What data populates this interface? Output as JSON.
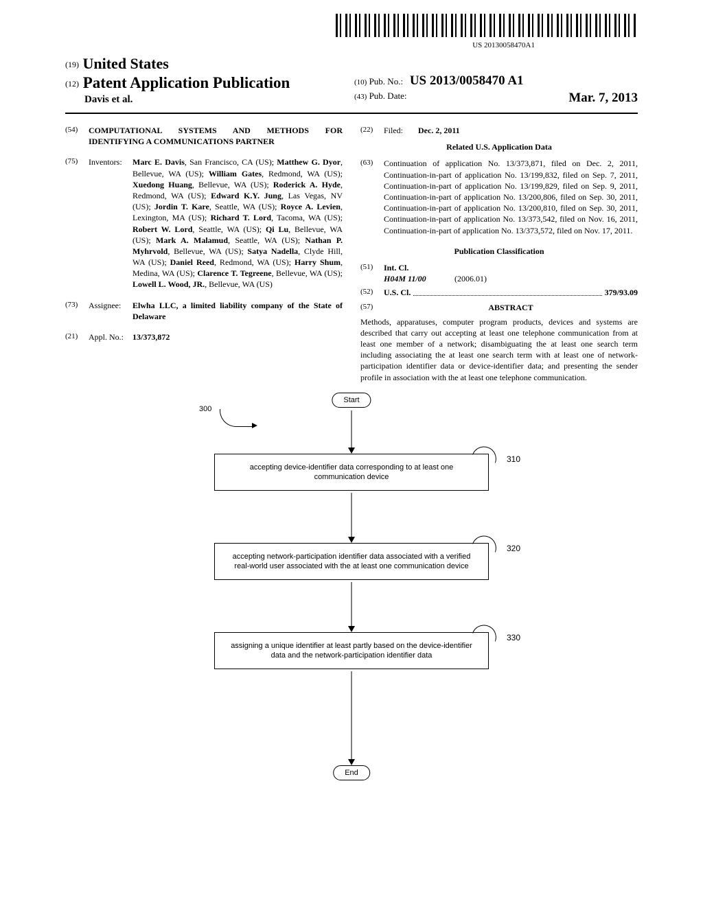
{
  "barcode_number": "US 20130058470A1",
  "header": {
    "country_num": "(19)",
    "country": "United States",
    "pub_num": "(12)",
    "pub_type": "Patent Application Publication",
    "authors": "Davis et al.",
    "pubno_num": "(10)",
    "pubno_label": "Pub. No.:",
    "pubno_value": "US 2013/0058470 A1",
    "pubdate_num": "(43)",
    "pubdate_label": "Pub. Date:",
    "pubdate_value": "Mar. 7, 2013"
  },
  "left": {
    "title_num": "(54)",
    "title": "COMPUTATIONAL SYSTEMS AND METHODS FOR IDENTIFYING A COMMUNICATIONS PARTNER",
    "inventors_num": "(75)",
    "inventors_label": "Inventors:",
    "inventors": [
      {
        "name": "Marc E. Davis",
        "loc": "San Francisco, CA (US)"
      },
      {
        "name": "Matthew G. Dyor",
        "loc": "Bellevue, WA (US)"
      },
      {
        "name": "William Gates",
        "loc": "Redmond, WA (US)"
      },
      {
        "name": "Xuedong Huang",
        "loc": "Bellevue, WA (US)"
      },
      {
        "name": "Roderick A. Hyde",
        "loc": "Redmond, WA (US)"
      },
      {
        "name": "Edward K.Y. Jung",
        "loc": "Las Vegas, NV (US)"
      },
      {
        "name": "Jordin T. Kare",
        "loc": "Seattle, WA (US)"
      },
      {
        "name": "Royce A. Levien",
        "loc": "Lexington, MA (US)"
      },
      {
        "name": "Richard T. Lord",
        "loc": "Tacoma, WA (US)"
      },
      {
        "name": "Robert W. Lord",
        "loc": "Seattle, WA (US)"
      },
      {
        "name": "Qi Lu",
        "loc": "Bellevue, WA (US)"
      },
      {
        "name": "Mark A. Malamud",
        "loc": "Seattle, WA (US)"
      },
      {
        "name": "Nathan P. Myhrvold",
        "loc": "Bellevue, WA (US)"
      },
      {
        "name": "Satya Nadella",
        "loc": "Clyde Hill, WA (US)"
      },
      {
        "name": "Daniel Reed",
        "loc": "Redmond, WA (US)"
      },
      {
        "name": "Harry Shum",
        "loc": "Medina, WA (US)"
      },
      {
        "name": "Clarence T. Tegreene",
        "loc": "Bellevue, WA (US)"
      },
      {
        "name": "Lowell L. Wood, JR.",
        "loc": "Bellevue, WA (US)"
      }
    ],
    "assignee_num": "(73)",
    "assignee_label": "Assignee:",
    "assignee": "Elwha LLC, a limited liability company of the State of Delaware",
    "applno_num": "(21)",
    "applno_label": "Appl. No.:",
    "applno": "13/373,872"
  },
  "right": {
    "filed_num": "(22)",
    "filed_label": "Filed:",
    "filed": "Dec. 2, 2011",
    "related_heading": "Related U.S. Application Data",
    "continuation_num": "(63)",
    "continuation": "Continuation of application No. 13/373,871, filed on Dec. 2, 2011, Continuation-in-part of application No. 13/199,832, filed on Sep. 7, 2011, Continuation-in-part of application No. 13/199,829, filed on Sep. 9, 2011, Continuation-in-part of application No. 13/200,806, filed on Sep. 30, 2011, Continuation-in-part of application No. 13/200,810, filed on Sep. 30, 2011, Continuation-in-part of application No. 13/373,542, filed on Nov. 16, 2011, Continuation-in-part of application No. 13/373,572, filed on Nov. 17, 2011.",
    "pubclass_heading": "Publication Classification",
    "intcl_num": "(51)",
    "intcl_label": "Int. Cl.",
    "intcl_code": "H04M 11/00",
    "intcl_year": "(2006.01)",
    "uscl_num": "(52)",
    "uscl_label": "U.S. Cl.",
    "uscl_value": "379/93.09",
    "abstract_num": "(57)",
    "abstract_label": "ABSTRACT",
    "abstract": "Methods, apparatuses, computer program products, devices and systems are described that carry out accepting at least one telephone communication from at least one member of a network; disambiguating the at least one search term including associating the at least one search term with at least one of network-participation identifier data or device-identifier data; and presenting the sender profile in association with the at least one telephone communication."
  },
  "flowchart": {
    "label300": "300",
    "start": "Start",
    "end": "End",
    "step1_num": "310",
    "step1": "accepting device-identifier data corresponding to at least one communication device",
    "step2_num": "320",
    "step2": "accepting network-participation identifier data associated with a verified real-world user associated with the at least one communication device",
    "step3_num": "330",
    "step3": "assigning a unique identifier at least partly based on the device-identifier data and the network-participation identifier data"
  }
}
